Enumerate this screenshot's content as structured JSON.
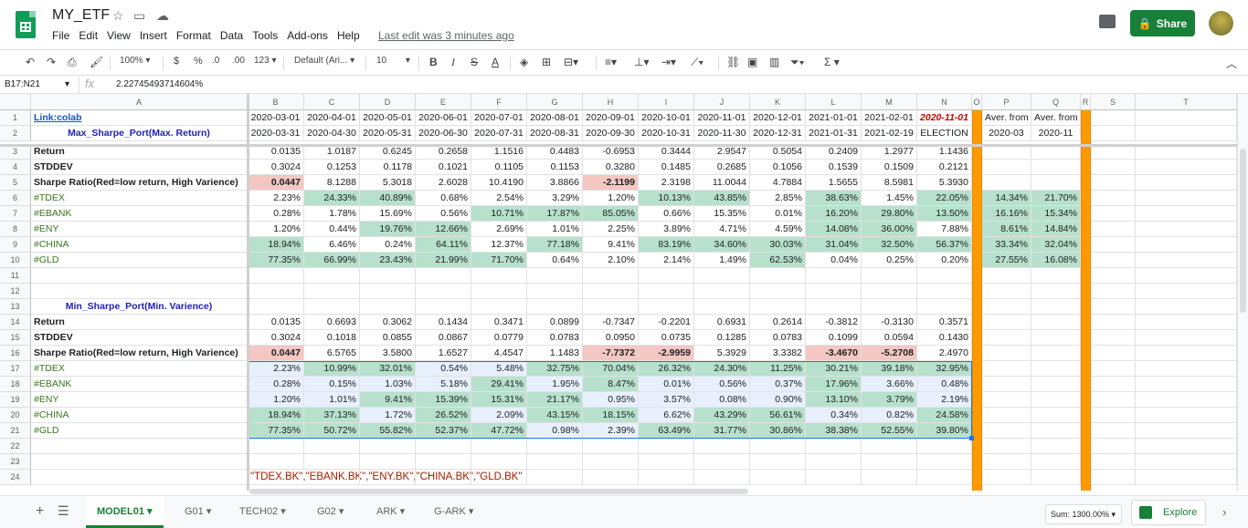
{
  "app": {
    "doc_title": "MY_ETF",
    "menu": [
      "File",
      "Edit",
      "View",
      "Insert",
      "Format",
      "Data",
      "Tools",
      "Add-ons",
      "Help"
    ],
    "last_edit": "Last edit was 3 minutes ago",
    "share_label": "Share",
    "brand_color": "#188038"
  },
  "toolbar": {
    "zoom": "100%",
    "currency": "$",
    "percent": "%",
    "dec_less": ".0",
    "dec_more": ".00",
    "more_formats": "123",
    "font": "Default (Ari...",
    "font_size": "10"
  },
  "formula_bar": {
    "name_box": "B17:N21",
    "fx": "fx",
    "value": "2.22745493714604%"
  },
  "columns": [
    "A",
    "B",
    "C",
    "D",
    "E",
    "F",
    "G",
    "H",
    "I",
    "J",
    "K",
    "L",
    "M",
    "N",
    "O",
    "P",
    "Q",
    "R",
    "S",
    "T"
  ],
  "rows": [
    {
      "n": "1",
      "cells": {
        "A": "Link:colab",
        "B": "2020-03-01",
        "C": "2020-04-01",
        "D": "2020-05-01",
        "E": "2020-06-01",
        "F": "2020-07-01",
        "G": "2020-08-01",
        "H": "2020-09-01",
        "I": "2020-10-01",
        "J": "2020-11-01",
        "K": "2020-12-01",
        "L": "2021-01-01",
        "M": "2021-02-01",
        "N": "2020-11-01",
        "P": "Aver. from",
        "Q": "Aver. from"
      }
    },
    {
      "n": "2",
      "cells": {
        "A": "Max_Sharpe_Port(Max. Return)",
        "B": "2020-03-31",
        "C": "2020-04-30",
        "D": "2020-05-31",
        "E": "2020-06-30",
        "F": "2020-07-31",
        "G": "2020-08-31",
        "H": "2020-09-30",
        "I": "2020-10-31",
        "J": "2020-11-30",
        "K": "2020-12-31",
        "L": "2021-01-31",
        "M": "2021-02-19",
        "N": "ELECTION",
        "P": "2020-03",
        "Q": "2020-11"
      }
    },
    {
      "n": "3",
      "cells": {
        "A": "Return",
        "B": "0.0135",
        "C": "1.0187",
        "D": "0.6245",
        "E": "0.2658",
        "F": "1.1516",
        "G": "0.4483",
        "H": "-0.6953",
        "I": "0.3444",
        "J": "2.9547",
        "K": "0.5054",
        "L": "0.2409",
        "M": "1.2977",
        "N": "1.1436"
      }
    },
    {
      "n": "4",
      "cells": {
        "A": "STDDEV",
        "B": "0.3024",
        "C": "0.1253",
        "D": "0.1178",
        "E": "0.1021",
        "F": "0.1105",
        "G": "0.1153",
        "H": "0.3280",
        "I": "0.1485",
        "J": "0.2685",
        "K": "0.1056",
        "L": "0.1539",
        "M": "0.1509",
        "N": "0.2121"
      }
    },
    {
      "n": "5",
      "cells": {
        "A": "Sharpe Ratio(Red=low return, High Varience)",
        "B": "0.0447",
        "C": "8.1288",
        "D": "5.3018",
        "E": "2.6028",
        "F": "10.4190",
        "G": "3.8866",
        "H": "-2.1199",
        "I": "2.3198",
        "J": "11.0044",
        "K": "4.7884",
        "L": "1.5655",
        "M": "8.5981",
        "N": "5.3930"
      }
    },
    {
      "n": "6",
      "cells": {
        "A": "#TDEX",
        "B": "2.23%",
        "C": "24.33%",
        "D": "40.89%",
        "E": "0.68%",
        "F": "2.54%",
        "G": "3.29%",
        "H": "1.20%",
        "I": "10.13%",
        "J": "43.85%",
        "K": "2.85%",
        "L": "38.63%",
        "M": "1.45%",
        "N": "22.05%",
        "P": "14.34%",
        "Q": "21.70%"
      }
    },
    {
      "n": "7",
      "cells": {
        "A": "#EBANK",
        "B": "0.28%",
        "C": "1.78%",
        "D": "15.69%",
        "E": "0.56%",
        "F": "10.71%",
        "G": "17.87%",
        "H": "85.05%",
        "I": "0.66%",
        "J": "15.35%",
        "K": "0.01%",
        "L": "16.20%",
        "M": "29.80%",
        "N": "13.50%",
        "P": "16.16%",
        "Q": "15.34%"
      }
    },
    {
      "n": "8",
      "cells": {
        "A": "#ENY",
        "B": "1.20%",
        "C": "0.44%",
        "D": "19.76%",
        "E": "12.66%",
        "F": "2.69%",
        "G": "1.01%",
        "H": "2.25%",
        "I": "3.89%",
        "J": "4.71%",
        "K": "4.59%",
        "L": "14.08%",
        "M": "36.00%",
        "N": "7.88%",
        "P": "8.61%",
        "Q": "14.84%"
      }
    },
    {
      "n": "9",
      "cells": {
        "A": "#CHINA",
        "B": "18.94%",
        "C": "6.46%",
        "D": "0.24%",
        "E": "64.11%",
        "F": "12.37%",
        "G": "77.18%",
        "H": "9.41%",
        "I": "83.19%",
        "J": "34.60%",
        "K": "30.03%",
        "L": "31.04%",
        "M": "32.50%",
        "N": "56.37%",
        "P": "33.34%",
        "Q": "32.04%"
      }
    },
    {
      "n": "10",
      "cells": {
        "A": "#GLD",
        "B": "77.35%",
        "C": "66.99%",
        "D": "23.43%",
        "E": "21.99%",
        "F": "71.70%",
        "G": "0.64%",
        "H": "2.10%",
        "I": "2.14%",
        "J": "1.49%",
        "K": "62.53%",
        "L": "0.04%",
        "M": "0.25%",
        "N": "0.20%",
        "P": "27.55%",
        "Q": "16.08%"
      }
    },
    {
      "n": "11",
      "cells": {}
    },
    {
      "n": "12",
      "cells": {}
    },
    {
      "n": "13",
      "cells": {
        "A": "Min_Sharpe_Port(Min. Varience)"
      }
    },
    {
      "n": "14",
      "cells": {
        "A": "Return",
        "B": "0.0135",
        "C": "0.6693",
        "D": "0.3062",
        "E": "0.1434",
        "F": "0.3471",
        "G": "0.0899",
        "H": "-0.7347",
        "I": "-0.2201",
        "J": "0.6931",
        "K": "0.2614",
        "L": "-0.3812",
        "M": "-0.3130",
        "N": "0.3571"
      }
    },
    {
      "n": "15",
      "cells": {
        "A": "STDDEV",
        "B": "0.3024",
        "C": "0.1018",
        "D": "0.0855",
        "E": "0.0867",
        "F": "0.0779",
        "G": "0.0783",
        "H": "0.0950",
        "I": "0.0735",
        "J": "0.1285",
        "K": "0.0783",
        "L": "0.1099",
        "M": "0.0594",
        "N": "0.1430"
      }
    },
    {
      "n": "16",
      "cells": {
        "A": "Sharpe Ratio(Red=low return, High Varience)",
        "B": "0.0447",
        "C": "6.5765",
        "D": "3.5800",
        "E": "1.6527",
        "F": "4.4547",
        "G": "1.1483",
        "H": "-7.7372",
        "I": "-2.9959",
        "J": "5.3929",
        "K": "3.3382",
        "L": "-3.4670",
        "M": "-5.2708",
        "N": "2.4970"
      }
    },
    {
      "n": "17",
      "cells": {
        "A": "#TDEX",
        "B": "2.23%",
        "C": "10.99%",
        "D": "32.01%",
        "E": "0.54%",
        "F": "5.48%",
        "G": "32.75%",
        "H": "70.04%",
        "I": "26.32%",
        "J": "24.30%",
        "K": "11.25%",
        "L": "30.21%",
        "M": "39.18%",
        "N": "32.95%"
      }
    },
    {
      "n": "18",
      "cells": {
        "A": "#EBANK",
        "B": "0.28%",
        "C": "0.15%",
        "D": "1.03%",
        "E": "5.18%",
        "F": "29.41%",
        "G": "1.95%",
        "H": "8.47%",
        "I": "0.01%",
        "J": "0.56%",
        "K": "0.37%",
        "L": "17.96%",
        "M": "3.66%",
        "N": "0.48%"
      }
    },
    {
      "n": "19",
      "cells": {
        "A": "#ENY",
        "B": "1.20%",
        "C": "1.01%",
        "D": "9.41%",
        "E": "15.39%",
        "F": "15.31%",
        "G": "21.17%",
        "H": "0.95%",
        "I": "3.57%",
        "J": "0.08%",
        "K": "0.90%",
        "L": "13.10%",
        "M": "3.79%",
        "N": "2.19%"
      }
    },
    {
      "n": "20",
      "cells": {
        "A": "#CHINA",
        "B": "18.94%",
        "C": "37.13%",
        "D": "1.72%",
        "E": "26.52%",
        "F": "2.09%",
        "G": "43.15%",
        "H": "18.15%",
        "I": "6.62%",
        "J": "43.29%",
        "K": "56.61%",
        "L": "0.34%",
        "M": "0.82%",
        "N": "24.58%"
      }
    },
    {
      "n": "21",
      "cells": {
        "A": "#GLD",
        "B": "77.35%",
        "C": "50.72%",
        "D": "55.82%",
        "E": "52.37%",
        "F": "47.72%",
        "G": "0.98%",
        "H": "2.39%",
        "I": "63.49%",
        "J": "31.77%",
        "K": "30.86%",
        "L": "38.38%",
        "M": "52.55%",
        "N": "39.80%"
      }
    },
    {
      "n": "22",
      "cells": {}
    },
    {
      "n": "23",
      "cells": {}
    },
    {
      "n": "24",
      "cells": {
        "B": "\"TDEX.BK\",\"EBANK.BK\",\"ENY.BK\",\"CHINA.BK\",\"GLD.BK\""
      }
    }
  ],
  "sheet_tabs": [
    "MODEL01",
    "G01",
    "TECH02",
    "G02",
    "ARK",
    "G-ARK"
  ],
  "active_tab": "MODEL01",
  "status": {
    "sum": "Sum: 1300.00%",
    "explore": "Explore"
  },
  "colors": {
    "green_fill": "#b7e1cd",
    "red_fill": "#f4c7c3",
    "light_green": "#d9ead3",
    "orange": "#ff9900",
    "link": "#1155cc",
    "label_green": "#38761d",
    "header_blue": "#1f1fbb",
    "red_text": "#cc0000"
  }
}
